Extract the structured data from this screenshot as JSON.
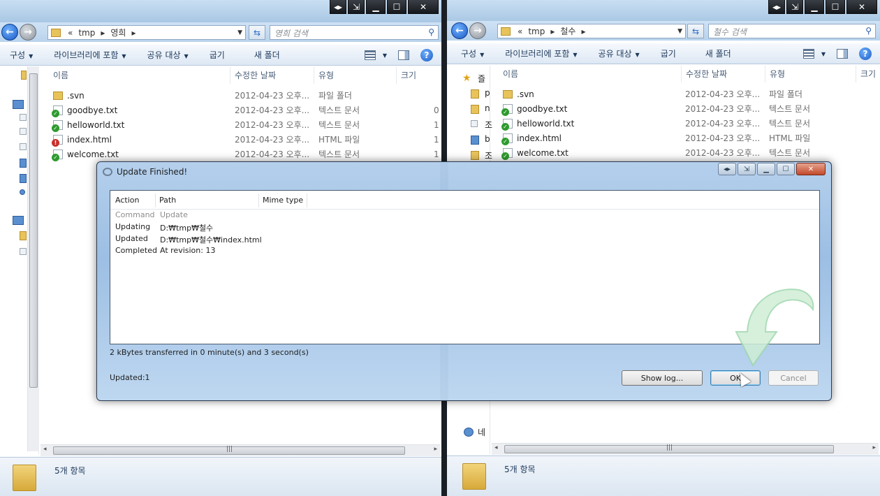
{
  "left_window": {
    "breadcrumb": [
      "«",
      "tmp",
      "▸",
      "영희",
      "▸"
    ],
    "search_placeholder": "영희 검색",
    "toolbar": {
      "organize": "구성",
      "include_library": "라이브러리에 포함",
      "share": "공유 대상",
      "burn": "굽기",
      "new_folder": "새 폴더"
    },
    "columns": {
      "name": "이름",
      "date": "수정한 날짜",
      "type": "유형",
      "size": "크기"
    },
    "files": [
      {
        "name": ".svn",
        "date": "2012-04-23 오후...",
        "type": "파일 폴더",
        "size": "",
        "icon": "folder"
      },
      {
        "name": "goodbye.txt",
        "date": "2012-04-23 오후...",
        "type": "텍스트 문서",
        "size": "0",
        "icon": "ok"
      },
      {
        "name": "helloworld.txt",
        "date": "2012-04-23 오후...",
        "type": "텍스트 문서",
        "size": "1",
        "icon": "ok"
      },
      {
        "name": "index.html",
        "date": "2012-04-23 오후...",
        "type": "HTML 파일",
        "size": "1",
        "icon": "modified"
      },
      {
        "name": "welcome.txt",
        "date": "2012-04-23 오후...",
        "type": "텍스트 문서",
        "size": "1",
        "icon": "ok"
      }
    ],
    "status": "5개 항목"
  },
  "right_window": {
    "breadcrumb": [
      "«",
      "tmp",
      "▸",
      "철수",
      "▸"
    ],
    "search_placeholder": "철수 검색",
    "toolbar": {
      "organize": "구성",
      "include_library": "라이브러리에 포함",
      "share": "공유 대상",
      "burn": "굽기",
      "new_folder": "새 폴더"
    },
    "columns": {
      "name": "이름",
      "date": "수정한 날짜",
      "type": "유형",
      "size": "크기"
    },
    "nav_items": [
      "즐",
      "p",
      "n",
      "조",
      "b",
      "조",
      "네"
    ],
    "files": [
      {
        "name": ".svn",
        "date": "2012-04-23 오후...",
        "type": "파일 폴더",
        "icon": "folder"
      },
      {
        "name": "goodbye.txt",
        "date": "2012-04-23 오후...",
        "type": "텍스트 문서",
        "icon": "ok"
      },
      {
        "name": "helloworld.txt",
        "date": "2012-04-23 오후...",
        "type": "텍스트 문서",
        "icon": "ok"
      },
      {
        "name": "index.html",
        "date": "2012-04-23 오후...",
        "type": "HTML 파일",
        "icon": "ok"
      },
      {
        "name": "welcome.txt",
        "date": "2012-04-23 오후...",
        "type": "텍스트 문서",
        "icon": "ok"
      }
    ],
    "status": "5개 항목"
  },
  "dialog": {
    "title": "Update Finished!",
    "columns": {
      "action": "Action",
      "path": "Path",
      "mime": "Mime type"
    },
    "rows": [
      {
        "action": "Command",
        "path": "Update",
        "dim": true
      },
      {
        "action": "Updating",
        "path": "D:₩tmp₩철수",
        "dim": false
      },
      {
        "action": "Updated",
        "path": "D:₩tmp₩철수₩index.html",
        "dim": false
      },
      {
        "action": "Completed",
        "path": "At revision: 13",
        "dim": false
      }
    ],
    "transfer_info": "2 kBytes transferred in 0 minute(s) and 3 second(s)",
    "updated_count": "Updated:1",
    "buttons": {
      "show_log": "Show log...",
      "ok": "OK",
      "cancel": "Cancel"
    }
  },
  "colors": {
    "accent": "#1a5bc4",
    "ok_overlay": "#2e9b2e",
    "modified_overlay": "#c9302c"
  }
}
